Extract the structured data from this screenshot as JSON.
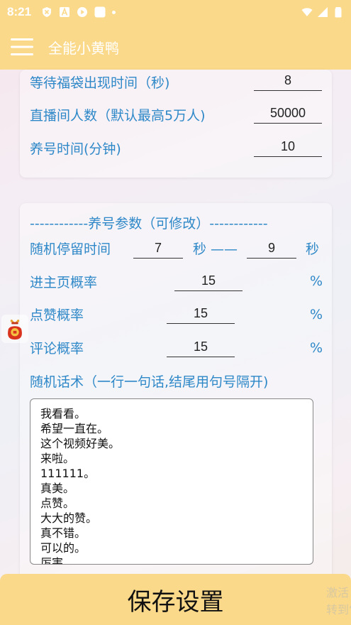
{
  "status_bar": {
    "time": "8:21",
    "icons": [
      "shield-x-icon",
      "font-a-icon",
      "play-icon",
      "app-square-icon",
      "dot-icon"
    ],
    "right_icons": [
      "wifi-icon",
      "cellular-icon",
      "battery-icon"
    ]
  },
  "app_bar": {
    "title": "全能小黄鸭",
    "menu_icon": "hamburger-menu-icon"
  },
  "top_settings": {
    "rows": [
      {
        "label": "等待福袋出现时间（秒)",
        "value": "8"
      },
      {
        "label": "直播间人数（默认最高5万人)",
        "value": "50000"
      },
      {
        "label": "养号时间(分钟)",
        "value": "10"
      }
    ]
  },
  "nurture": {
    "section_title": "------------养号参数（可修改）------------",
    "random_stay": {
      "label": "随机停留时间",
      "min": "7",
      "unit1": "秒 ——",
      "max": "9",
      "unit2": "秒"
    },
    "rows": [
      {
        "label": "进主页概率",
        "value": "15",
        "unit": "%"
      },
      {
        "label": "点赞概率",
        "value": "15",
        "unit": "%"
      },
      {
        "label": "评论概率",
        "value": "15",
        "unit": "%"
      }
    ],
    "phrases_label": "随机话术（一行一句话,结尾用句号隔开)",
    "phrases": [
      "我看看。",
      "希望一直在。",
      "这个视频好美。",
      "来啦。",
      "111111。",
      "真美。",
      "点赞。",
      "大大的赞。",
      "真不错。",
      "可以的。",
      "厉害。"
    ]
  },
  "bottom": {
    "save_label": "保存设置",
    "watermark_line1": "激活",
    "watermark_line2": "转到“"
  },
  "colors": {
    "accent": "#fbd98a",
    "label_blue": "#2e88c8"
  }
}
